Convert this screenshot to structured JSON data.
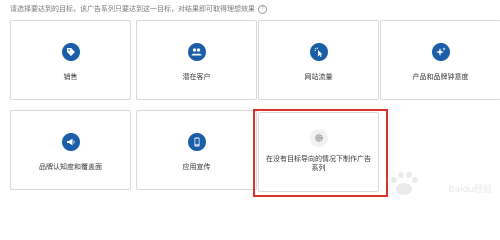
{
  "instruction": {
    "text": "请选择要达到的目标，该广告系列只要达到这一目标，对结果即可取得理想效果",
    "help_icon": "help-circle-icon"
  },
  "cards": [
    {
      "label": "销售",
      "icon": "tag-icon"
    },
    {
      "label": "潜在客户",
      "icon": "people-icon"
    },
    {
      "label": "网站流量",
      "icon": "cursor-click-icon"
    },
    {
      "label": "产品和品牌钟意度",
      "icon": "sparkle-icon"
    },
    {
      "label": "品牌认知度和覆盖面",
      "icon": "megaphone-icon"
    },
    {
      "label": "应用宣传",
      "icon": "smartphone-icon"
    },
    {
      "label": "在没有目标导向的情况下制作广告系列",
      "icon": "gear-icon"
    }
  ],
  "watermark": {
    "text": "Baidu经验"
  },
  "colors": {
    "icon_blue": "#1a5ea8",
    "highlight_red": "#e0322d",
    "card_border": "#d9d9d9"
  }
}
